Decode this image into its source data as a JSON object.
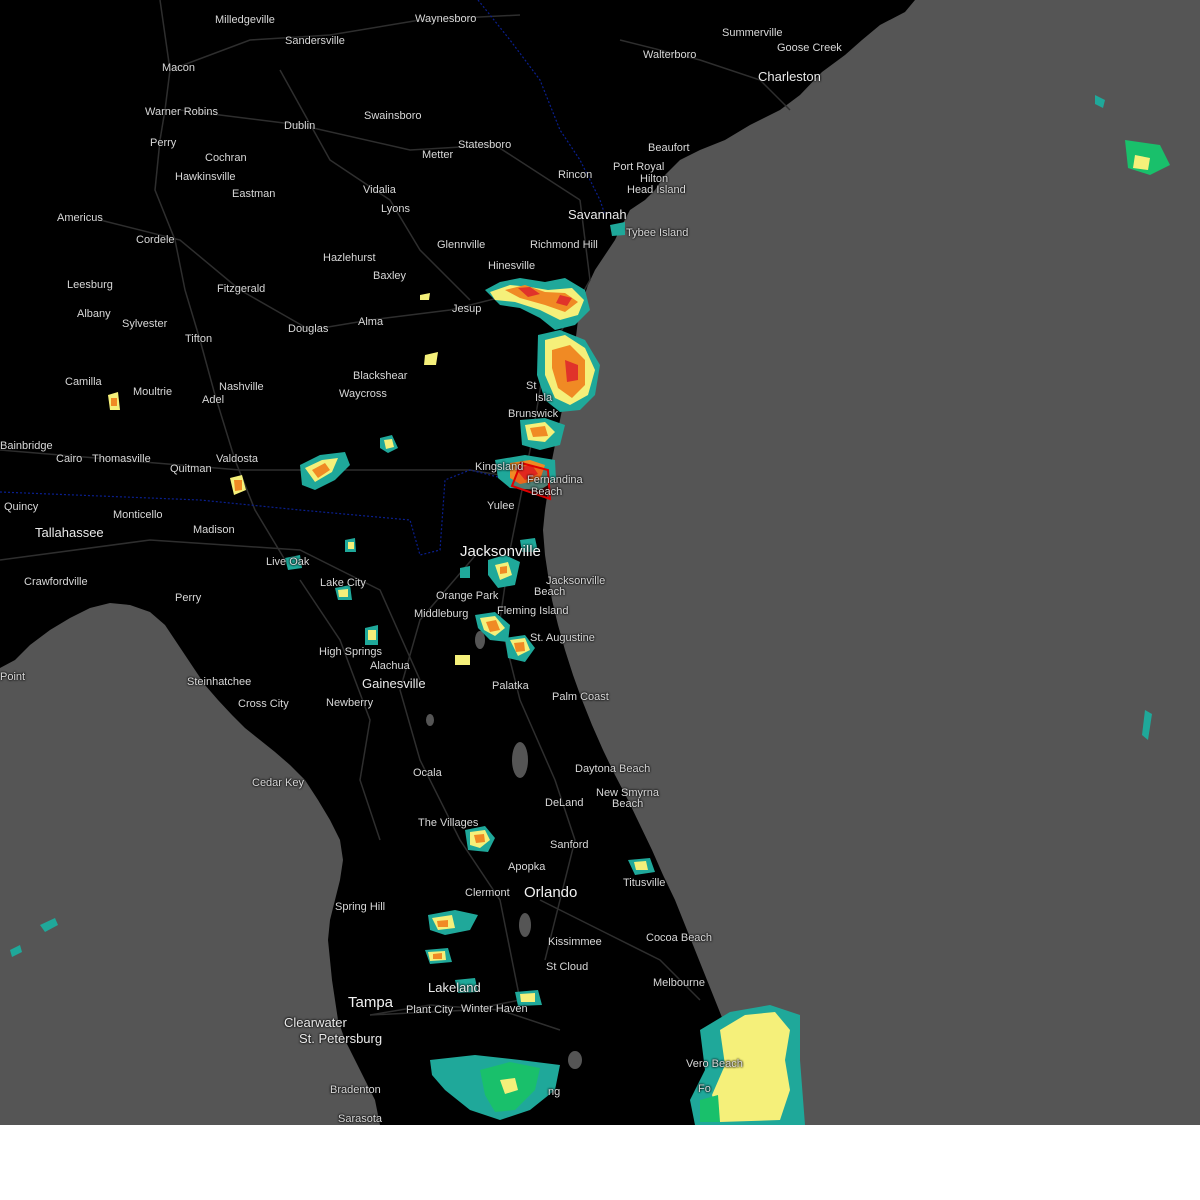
{
  "map": {
    "colors": {
      "ocean": "#555555",
      "land": "#000000",
      "road": "#2e2e2e",
      "state_border": "#0a1f8f",
      "warning_polygon": "#e00000",
      "radar_light": "#1fa89a",
      "radar_green": "#19c06b",
      "radar_yellow": "#f5f07a",
      "radar_orange": "#f08a24",
      "radar_red": "#e0332a"
    },
    "cities": [
      {
        "name": "Milledgeville",
        "class": "minor"
      },
      {
        "name": "Waynesboro",
        "class": "minor"
      },
      {
        "name": "Summerville",
        "class": "minor"
      },
      {
        "name": "Goose Creek",
        "class": "minor"
      },
      {
        "name": "Sandersville",
        "class": "minor"
      },
      {
        "name": "Walterboro",
        "class": "minor"
      },
      {
        "name": "Macon",
        "class": "minor"
      },
      {
        "name": "Charleston",
        "class": "mid"
      },
      {
        "name": "Warner Robins",
        "class": "minor"
      },
      {
        "name": "Swainsboro",
        "class": "minor"
      },
      {
        "name": "Dublin",
        "class": "minor"
      },
      {
        "name": "Perry",
        "class": "minor"
      },
      {
        "name": "Statesboro",
        "class": "minor"
      },
      {
        "name": "Beaufort",
        "class": "minor"
      },
      {
        "name": "Cochran",
        "class": "minor"
      },
      {
        "name": "Metter",
        "class": "minor"
      },
      {
        "name": "Port Royal",
        "class": "minor"
      },
      {
        "name": "Hilton",
        "class": "minor"
      },
      {
        "name": "Head Island",
        "class": "minor"
      },
      {
        "name": "Hawkinsville",
        "class": "minor"
      },
      {
        "name": "Rincon",
        "class": "minor"
      },
      {
        "name": "Vidalia",
        "class": "minor"
      },
      {
        "name": "Eastman",
        "class": "minor"
      },
      {
        "name": "Lyons",
        "class": "minor"
      },
      {
        "name": "Savannah",
        "class": "mid"
      },
      {
        "name": "Americus",
        "class": "minor"
      },
      {
        "name": "Tybee Island",
        "class": "minor"
      },
      {
        "name": "Cordele",
        "class": "minor"
      },
      {
        "name": "Glennville",
        "class": "minor"
      },
      {
        "name": "Richmond Hill",
        "class": "minor"
      },
      {
        "name": "Hazlehurst",
        "class": "minor"
      },
      {
        "name": "Hinesville",
        "class": "minor"
      },
      {
        "name": "Baxley",
        "class": "minor"
      },
      {
        "name": "Leesburg",
        "class": "minor"
      },
      {
        "name": "Fitzgerald",
        "class": "minor"
      },
      {
        "name": "Jesup",
        "class": "minor"
      },
      {
        "name": "Albany",
        "class": "minor"
      },
      {
        "name": "Douglas",
        "class": "minor"
      },
      {
        "name": "Sylvester",
        "class": "minor"
      },
      {
        "name": "Alma",
        "class": "minor"
      },
      {
        "name": "Tifton",
        "class": "minor"
      },
      {
        "name": "Blackshear",
        "class": "minor"
      },
      {
        "name": "Camilla",
        "class": "minor"
      },
      {
        "name": "Nashville",
        "class": "minor"
      },
      {
        "name": "St",
        "class": "minor"
      },
      {
        "name": "Moultrie",
        "class": "minor"
      },
      {
        "name": "Waycross",
        "class": "minor"
      },
      {
        "name": "Isla",
        "class": "minor"
      },
      {
        "name": "Adel",
        "class": "minor"
      },
      {
        "name": "Brunswick",
        "class": "minor"
      },
      {
        "name": "Bainbridge",
        "class": "minor"
      },
      {
        "name": "Cairo",
        "class": "minor"
      },
      {
        "name": "Thomasville",
        "class": "minor"
      },
      {
        "name": "Valdosta",
        "class": "minor"
      },
      {
        "name": "Quitman",
        "class": "minor"
      },
      {
        "name": "Kingsland",
        "class": "minor"
      },
      {
        "name": "Fernandina",
        "class": "minor"
      },
      {
        "name": "Beach",
        "class": "minor"
      },
      {
        "name": "Yulee",
        "class": "minor"
      },
      {
        "name": "Quincy",
        "class": "minor"
      },
      {
        "name": "Monticello",
        "class": "minor"
      },
      {
        "name": "Madison",
        "class": "minor"
      },
      {
        "name": "Tallahassee",
        "class": "mid"
      },
      {
        "name": "Jacksonville",
        "class": "major"
      },
      {
        "name": "Live Oak",
        "class": "minor"
      },
      {
        "name": "Crawfordville",
        "class": "minor"
      },
      {
        "name": "Lake City",
        "class": "minor"
      },
      {
        "name": "Jacksonville",
        "class": "minor"
      },
      {
        "name": "Beach",
        "class": "minor"
      },
      {
        "name": "Orange Park",
        "class": "minor"
      },
      {
        "name": "Perry",
        "class": "minor"
      },
      {
        "name": "Fleming Island",
        "class": "minor"
      },
      {
        "name": "Middleburg",
        "class": "minor"
      },
      {
        "name": "St. Augustine",
        "class": "minor"
      },
      {
        "name": "High Springs",
        "class": "minor"
      },
      {
        "name": "Alachua",
        "class": "minor"
      },
      {
        "name": "Point",
        "class": "minor"
      },
      {
        "name": "Steinhatchee",
        "class": "minor"
      },
      {
        "name": "Gainesville",
        "class": "mid"
      },
      {
        "name": "Palatka",
        "class": "minor"
      },
      {
        "name": "Palm Coast",
        "class": "minor"
      },
      {
        "name": "Newberry",
        "class": "minor"
      },
      {
        "name": "Cross City",
        "class": "minor"
      },
      {
        "name": "Ocala",
        "class": "minor"
      },
      {
        "name": "Daytona Beach",
        "class": "minor"
      },
      {
        "name": "Cedar Key",
        "class": "minor"
      },
      {
        "name": "New Smyrna",
        "class": "minor"
      },
      {
        "name": "Beach",
        "class": "minor"
      },
      {
        "name": "DeLand",
        "class": "minor"
      },
      {
        "name": "The Villages",
        "class": "minor"
      },
      {
        "name": "Sanford",
        "class": "minor"
      },
      {
        "name": "Apopka",
        "class": "minor"
      },
      {
        "name": "Titusville",
        "class": "minor"
      },
      {
        "name": "Clermont",
        "class": "minor"
      },
      {
        "name": "Orlando",
        "class": "major"
      },
      {
        "name": "Spring Hill",
        "class": "minor"
      },
      {
        "name": "Kissimmee",
        "class": "minor"
      },
      {
        "name": "Cocoa Beach",
        "class": "minor"
      },
      {
        "name": "St Cloud",
        "class": "minor"
      },
      {
        "name": "Lakeland",
        "class": "mid"
      },
      {
        "name": "Melbourne",
        "class": "minor"
      },
      {
        "name": "Tampa",
        "class": "major"
      },
      {
        "name": "Plant City",
        "class": "minor"
      },
      {
        "name": "Winter Haven",
        "class": "minor"
      },
      {
        "name": "Clearwater",
        "class": "mid"
      },
      {
        "name": "St. Petersburg",
        "class": "mid"
      },
      {
        "name": "Vero Beach",
        "class": "minor"
      },
      {
        "name": "Bradenton",
        "class": "minor"
      },
      {
        "name": "Fo",
        "class": "minor"
      },
      {
        "name": "Sarasota",
        "class": "minor"
      },
      {
        "name": "ng",
        "class": "minor"
      }
    ]
  }
}
